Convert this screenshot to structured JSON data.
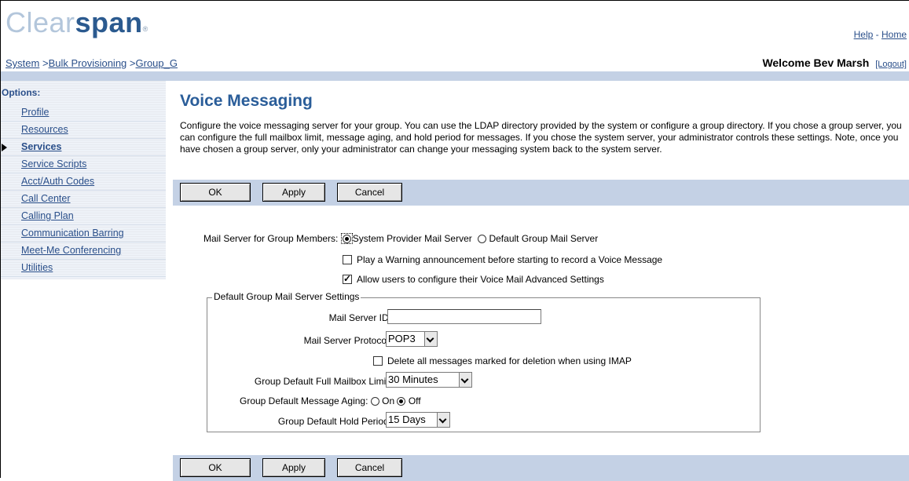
{
  "header": {
    "logo_part1": "Clear",
    "logo_part2": "span",
    "logo_mark": "®",
    "help_link": "Help",
    "links_separator": " - ",
    "home_link": "Home",
    "breadcrumb": [
      {
        "label": "System",
        "link": true
      },
      {
        "label": "Bulk Provisioning",
        "link": true
      },
      {
        "label": "Group_G",
        "link": true
      }
    ],
    "breadcrumb_separator": " >",
    "welcome_text": "Welcome Bev Marsh",
    "logout_link": "[Logout]"
  },
  "sidebar": {
    "title": "Options:",
    "items": [
      {
        "label": "Profile",
        "active": false
      },
      {
        "label": "Resources",
        "active": false
      },
      {
        "label": "Services",
        "active": true
      },
      {
        "label": "Service Scripts",
        "active": false
      },
      {
        "label": "Acct/Auth Codes",
        "active": false
      },
      {
        "label": "Call Center",
        "active": false
      },
      {
        "label": "Calling Plan",
        "active": false
      },
      {
        "label": "Communication Barring",
        "active": false
      },
      {
        "label": "Meet-Me Conferencing",
        "active": false
      },
      {
        "label": "Utilities",
        "active": false
      }
    ]
  },
  "main": {
    "title": "Voice Messaging",
    "description": "Configure the voice messaging server for your group. You can use the LDAP directory provided by the system or configure a group directory. If you chose a group server, you can configure the full mailbox limit, message aging, and hold period for messages. If you chose the system server, your administrator controls these settings. Note, once you have chosen a group server, only your administrator can change your messaging system back to the system server.",
    "buttons": {
      "ok": "OK",
      "apply": "Apply",
      "cancel": "Cancel"
    },
    "form": {
      "mail_server_label": "Mail Server for Group Members:",
      "radio_system": "System Provider Mail Server",
      "radio_default": "Default Group Mail Server",
      "mail_server_selected": "System Provider Mail Server",
      "play_warning_label": "Play a Warning announcement before starting to record a Voice Message",
      "play_warning_checked": false,
      "allow_users_label": "Allow users to configure their Voice Mail Advanced Settings",
      "allow_users_checked": true,
      "settings_legend": "Default Group Mail Server Settings",
      "mail_server_id_label": "Mail Server ID:",
      "mail_server_id_value": "",
      "protocol_label": "Mail Server Protocol:",
      "protocol_value": "POP3",
      "delete_label": "Delete all messages marked for deletion when using IMAP",
      "delete_checked": false,
      "mailbox_limit_label": "Group Default Full Mailbox Limit:",
      "mailbox_limit_value": "30 Minutes",
      "aging_label": "Group Default Message Aging:",
      "aging_on": "On",
      "aging_off": "Off",
      "aging_selected": "Off",
      "hold_period_label": "Group Default Hold Period:",
      "hold_period_value": "15 Days"
    }
  },
  "colors": {
    "band": "#c4d1e5",
    "title_blue": "#2a5d99",
    "link_blue": "#2a4f8a"
  }
}
